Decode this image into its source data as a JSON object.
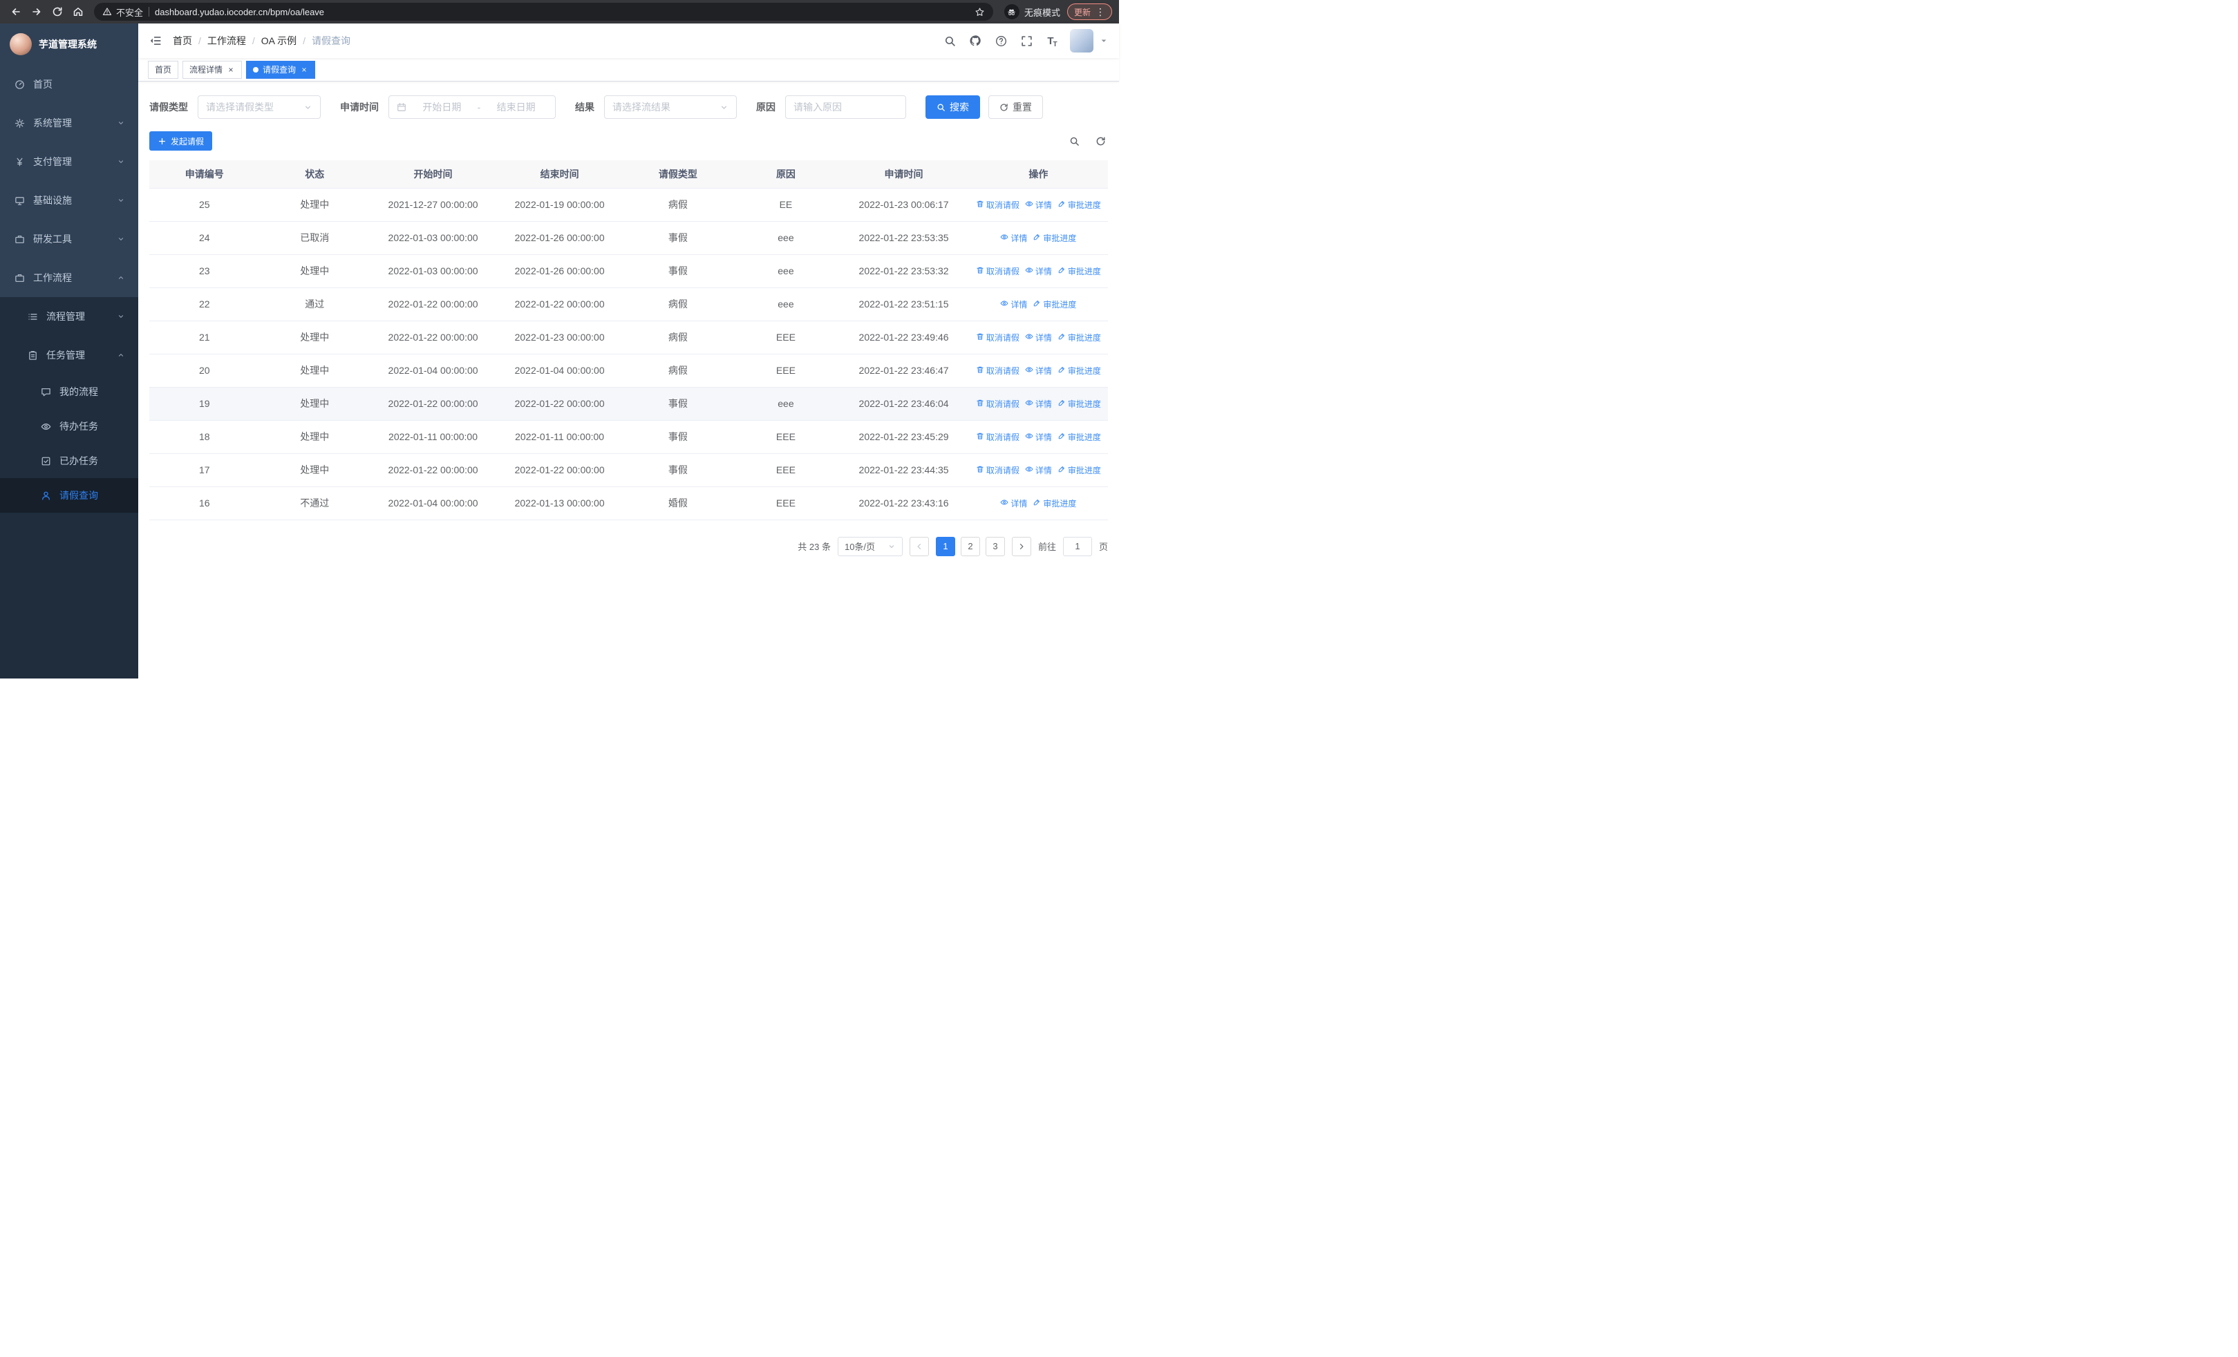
{
  "accent": "#2e80f0",
  "browser": {
    "security_label": "不安全",
    "url": "dashboard.yudao.iocoder.cn/bpm/oa/leave",
    "incognito_label": "无痕模式",
    "update_label": "更新"
  },
  "sidebar": {
    "app_title": "芋道管理系统",
    "items": [
      {
        "name": "home",
        "label": "首页",
        "icon": "dashboard-icon",
        "arrow": null
      },
      {
        "name": "system-management",
        "label": "系统管理",
        "icon": "gear-icon",
        "arrow": "down"
      },
      {
        "name": "payment-management",
        "label": "支付管理",
        "icon": "yen-icon",
        "arrow": "down"
      },
      {
        "name": "infrastructure",
        "label": "基础设施",
        "icon": "monitor-icon",
        "arrow": "down"
      },
      {
        "name": "dev-tools",
        "label": "研发工具",
        "icon": "briefcase-icon",
        "arrow": "down"
      },
      {
        "name": "workflow",
        "label": "工作流程",
        "icon": "briefcase-icon",
        "arrow": "up",
        "open": true
      }
    ],
    "submenu": [
      {
        "name": "process-management",
        "label": "流程管理",
        "icon": "list-icon",
        "arrow": "down",
        "children": []
      },
      {
        "name": "task-management",
        "label": "任务管理",
        "icon": "clipboard-icon",
        "arrow": "up",
        "open": true,
        "children": [
          {
            "name": "my-process",
            "label": "我的流程",
            "icon": "chat-icon",
            "active": false
          },
          {
            "name": "todo-tasks",
            "label": "待办任务",
            "icon": "eye-icon",
            "active": false
          },
          {
            "name": "done-tasks",
            "label": "已办任务",
            "icon": "check-square-icon",
            "active": false
          },
          {
            "name": "leave-query",
            "label": "请假查询",
            "icon": "user-icon",
            "active": true
          }
        ]
      }
    ]
  },
  "header": {
    "breadcrumb": [
      {
        "label": "首页",
        "current": false
      },
      {
        "label": "工作流程",
        "current": false
      },
      {
        "label": "OA 示例",
        "current": false
      },
      {
        "label": "请假查询",
        "current": true
      }
    ]
  },
  "tabs": [
    {
      "name": "home",
      "label": "首页",
      "active": false,
      "closable": false
    },
    {
      "name": "process-detail",
      "label": "流程详情",
      "active": false,
      "closable": true
    },
    {
      "name": "leave-query",
      "label": "请假查询",
      "active": true,
      "closable": true
    }
  ],
  "filters": {
    "leave_type_label": "请假类型",
    "leave_type_placeholder": "请选择请假类型",
    "apply_time_label": "申请时间",
    "date_start_placeholder": "开始日期",
    "date_separator": "-",
    "date_end_placeholder": "结束日期",
    "result_label": "结果",
    "result_placeholder": "请选择流结果",
    "reason_label": "原因",
    "reason_placeholder": "请输入原因",
    "search_button": "搜索",
    "reset_button": "重置"
  },
  "toolbar": {
    "create_button": "发起请假"
  },
  "table": {
    "headers": [
      "申请编号",
      "状态",
      "开始时间",
      "结束时间",
      "请假类型",
      "原因",
      "申请时间",
      "操作"
    ],
    "action_labels": {
      "cancel": "取消请假",
      "detail": "详情",
      "progress": "审批进度"
    },
    "rows": [
      {
        "id": "25",
        "status": "处理中",
        "start": "2021-12-27 00:00:00",
        "end": "2022-01-19 00:00:00",
        "type": "病假",
        "reason": "EE",
        "applied": "2022-01-23 00:06:17",
        "actions": [
          "cancel",
          "detail",
          "progress"
        ],
        "highlighted": false
      },
      {
        "id": "24",
        "status": "已取消",
        "start": "2022-01-03 00:00:00",
        "end": "2022-01-26 00:00:00",
        "type": "事假",
        "reason": "eee",
        "applied": "2022-01-22 23:53:35",
        "actions": [
          "detail",
          "progress"
        ],
        "highlighted": false
      },
      {
        "id": "23",
        "status": "处理中",
        "start": "2022-01-03 00:00:00",
        "end": "2022-01-26 00:00:00",
        "type": "事假",
        "reason": "eee",
        "applied": "2022-01-22 23:53:32",
        "actions": [
          "cancel",
          "detail",
          "progress"
        ],
        "highlighted": false
      },
      {
        "id": "22",
        "status": "通过",
        "start": "2022-01-22 00:00:00",
        "end": "2022-01-22 00:00:00",
        "type": "病假",
        "reason": "eee",
        "applied": "2022-01-22 23:51:15",
        "actions": [
          "detail",
          "progress"
        ],
        "highlighted": false
      },
      {
        "id": "21",
        "status": "处理中",
        "start": "2022-01-22 00:00:00",
        "end": "2022-01-23 00:00:00",
        "type": "病假",
        "reason": "EEE",
        "applied": "2022-01-22 23:49:46",
        "actions": [
          "cancel",
          "detail",
          "progress"
        ],
        "highlighted": false
      },
      {
        "id": "20",
        "status": "处理中",
        "start": "2022-01-04 00:00:00",
        "end": "2022-01-04 00:00:00",
        "type": "病假",
        "reason": "EEE",
        "applied": "2022-01-22 23:46:47",
        "actions": [
          "cancel",
          "detail",
          "progress"
        ],
        "highlighted": false
      },
      {
        "id": "19",
        "status": "处理中",
        "start": "2022-01-22 00:00:00",
        "end": "2022-01-22 00:00:00",
        "type": "事假",
        "reason": "eee",
        "applied": "2022-01-22 23:46:04",
        "actions": [
          "cancel",
          "detail",
          "progress"
        ],
        "highlighted": true
      },
      {
        "id": "18",
        "status": "处理中",
        "start": "2022-01-11 00:00:00",
        "end": "2022-01-11 00:00:00",
        "type": "事假",
        "reason": "EEE",
        "applied": "2022-01-22 23:45:29",
        "actions": [
          "cancel",
          "detail",
          "progress"
        ],
        "highlighted": false
      },
      {
        "id": "17",
        "status": "处理中",
        "start": "2022-01-22 00:00:00",
        "end": "2022-01-22 00:00:00",
        "type": "事假",
        "reason": "EEE",
        "applied": "2022-01-22 23:44:35",
        "actions": [
          "cancel",
          "detail",
          "progress"
        ],
        "highlighted": false
      },
      {
        "id": "16",
        "status": "不通过",
        "start": "2022-01-04 00:00:00",
        "end": "2022-01-13 00:00:00",
        "type": "婚假",
        "reason": "EEE",
        "applied": "2022-01-22 23:43:16",
        "actions": [
          "detail",
          "progress"
        ],
        "highlighted": false
      }
    ]
  },
  "pagination": {
    "total_label": "共 23 条",
    "page_size": "10条/页",
    "pages": [
      "1",
      "2",
      "3"
    ],
    "active_page": "1",
    "goto_label": "前往",
    "goto_value": "1",
    "goto_unit": "页"
  }
}
